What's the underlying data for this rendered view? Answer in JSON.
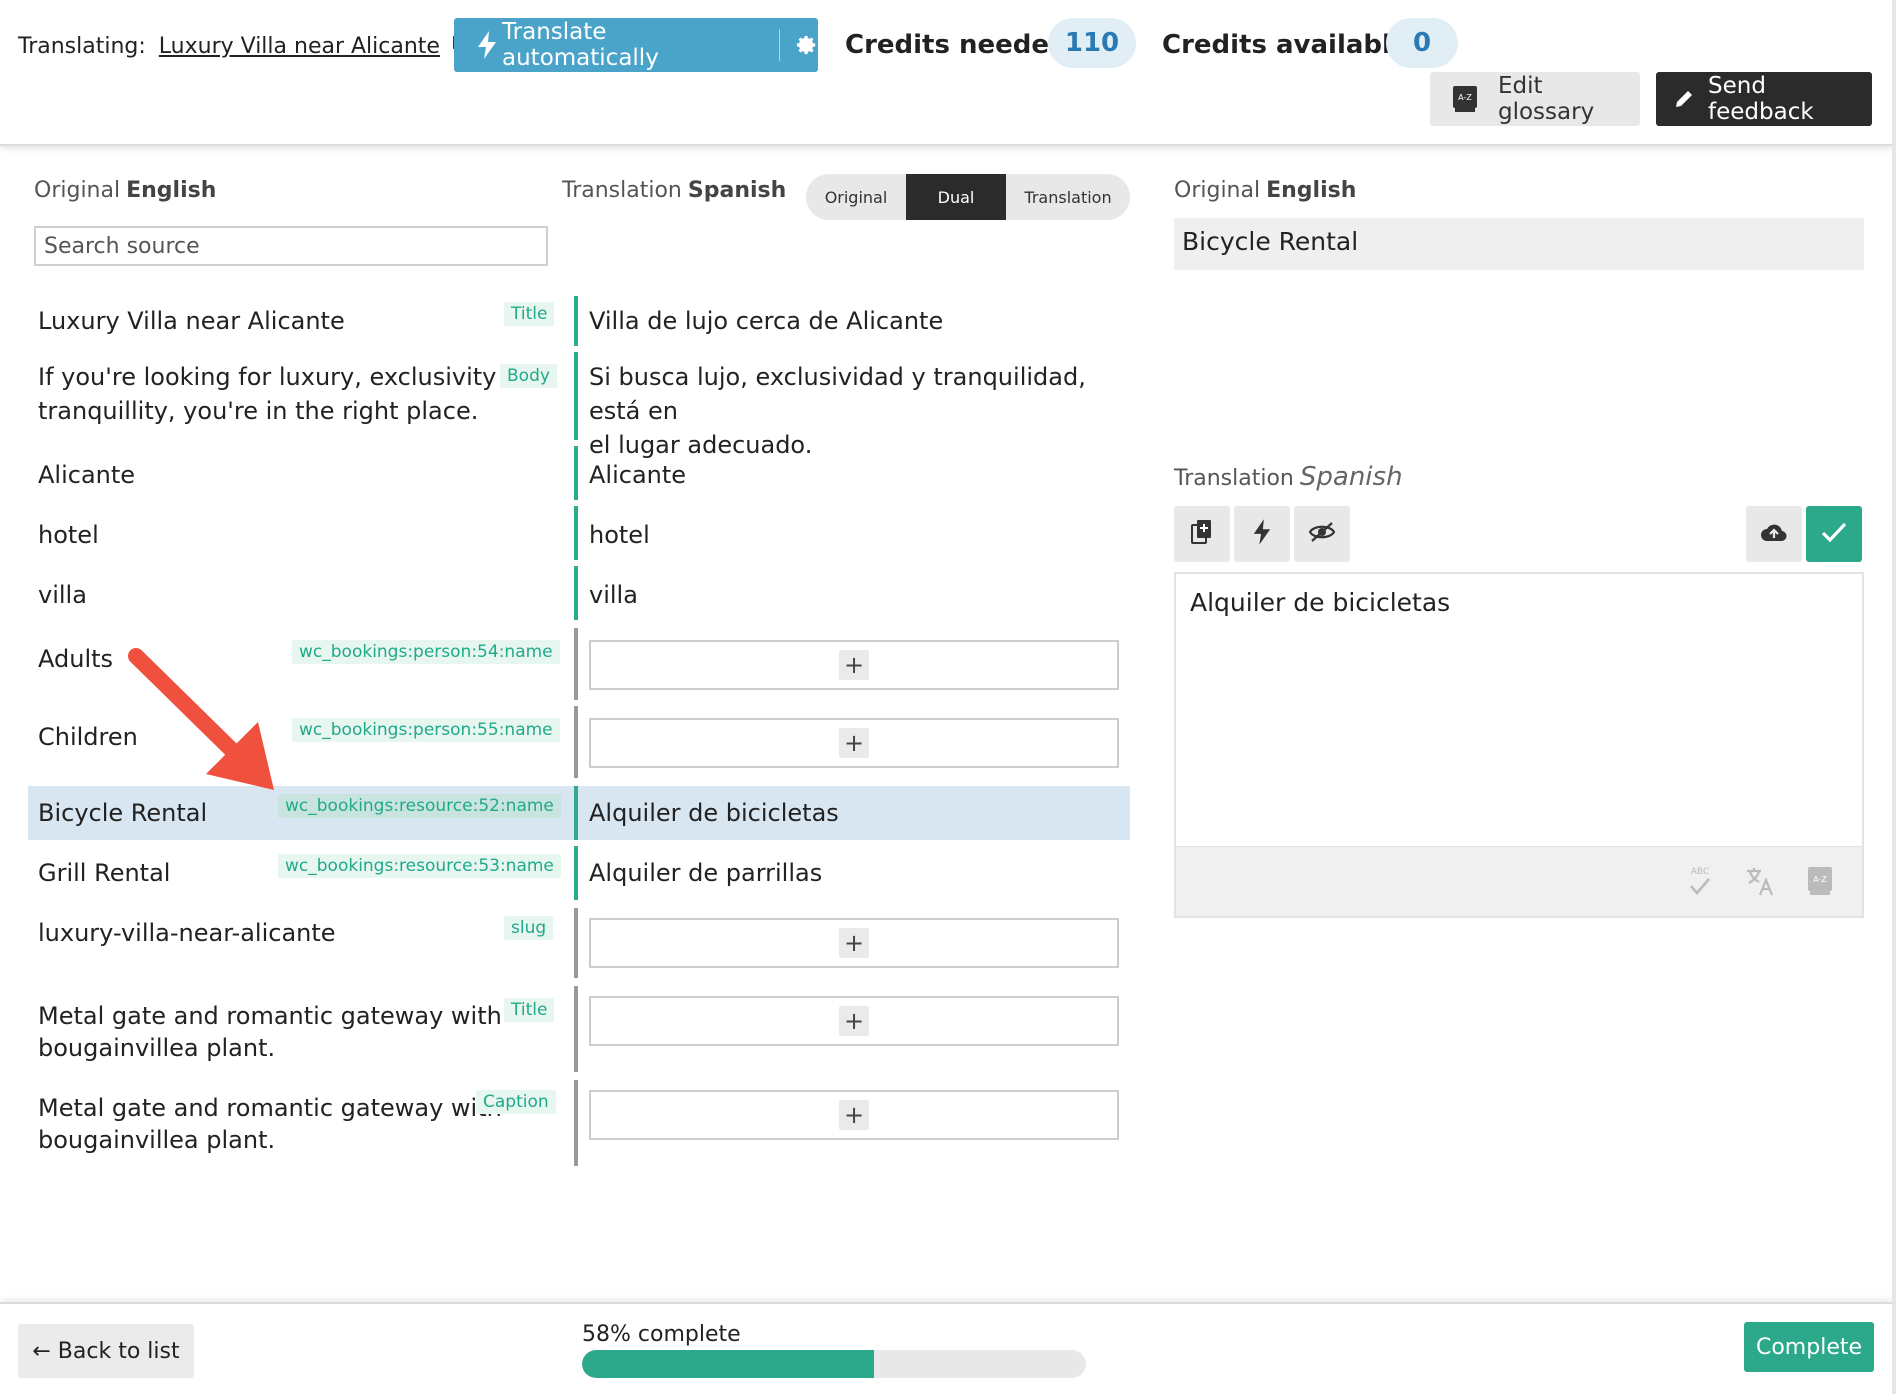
{
  "header": {
    "translating_label": "Translating:",
    "translating_link": "Luxury Villa near Alicante",
    "translate_auto_label": "Translate automatically",
    "credits_needed_label": "Credits needed",
    "credits_needed_value": "110",
    "credits_available_label": "Credits available",
    "credits_available_value": "0",
    "edit_glossary_label": "Edit glossary",
    "send_feedback_label": "Send feedback"
  },
  "left": {
    "original_label": "Original",
    "original_lang": "English",
    "translation_label": "Translation",
    "translation_lang": "Spanish",
    "search_placeholder": "Search source",
    "view_modes": [
      "Original",
      "Dual",
      "Translation"
    ],
    "active_view": "Dual"
  },
  "rows": [
    {
      "source": "Luxury Villa near Alicante",
      "tag": "Title",
      "translation": "Villa de lujo cerca de Alicante"
    },
    {
      "source_lines": [
        "If you're looking for luxury, exclusivity and",
        "tranquillity, you're in the right place."
      ],
      "tag": "Body",
      "translation_lines": [
        "Si busca lujo, exclusividad y tranquilidad, está en",
        "el lugar adecuado."
      ]
    },
    {
      "source": "Alicante",
      "tag": "",
      "translation": "Alicante"
    },
    {
      "source": "hotel",
      "tag": "",
      "translation": "hotel"
    },
    {
      "source": "villa",
      "tag": "",
      "translation": "villa"
    },
    {
      "source": "Adults",
      "tag": "wc_bookings:person:54:name",
      "translation": ""
    },
    {
      "source": "Children",
      "tag": "wc_bookings:person:55:name",
      "translation": ""
    },
    {
      "source": "Bicycle Rental",
      "tag": "wc_bookings:resource:52:name",
      "translation": "Alquiler de bicicletas",
      "selected": true
    },
    {
      "source": "Grill Rental",
      "tag": "wc_bookings:resource:53:name",
      "translation": "Alquiler de parrillas"
    },
    {
      "source": "luxury-villa-near-alicante",
      "tag": "slug",
      "translation": ""
    },
    {
      "source_lines": [
        "Metal gate and romantic gateway with",
        "bougainvillea plant."
      ],
      "tag": "Title",
      "translation": ""
    },
    {
      "source_lines": [
        "Metal gate and romantic gateway with",
        "bougainvillea plant."
      ],
      "tag": "Caption",
      "translation": ""
    }
  ],
  "add_label": "+",
  "right": {
    "original_label": "Original",
    "original_lang": "English",
    "original_text": "Bicycle Rental",
    "translation_label": "Translation",
    "translation_lang": "Spanish",
    "editor_text": "Alquiler de bicicletas",
    "toolbar_icons": [
      "copy-source-icon",
      "bolt-icon",
      "hide-icon",
      "cloud-upload-icon",
      "checkmark-icon"
    ],
    "footer_icons": [
      "spellcheck-icon",
      "translate-icon",
      "glossary-icon"
    ]
  },
  "footer": {
    "back_label": "← Back to list",
    "progress_label": "58% complete",
    "progress_value": 0.58,
    "complete_label": "Complete"
  },
  "colors": {
    "accent_blue": "#4aa3c8",
    "accent_green": "#2ba98a",
    "selected_row": "#d7e6f1",
    "annotation_arrow": "#f0513e"
  }
}
